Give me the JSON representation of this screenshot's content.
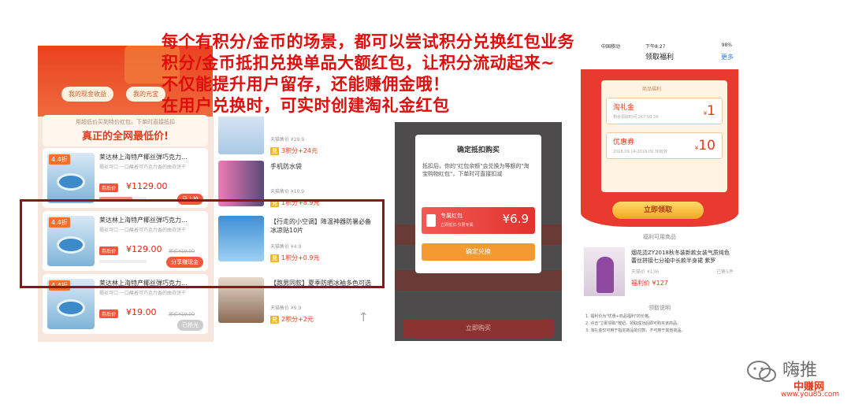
{
  "headline": [
    "每个有积分/金币的场景，都可以尝试积分兑换红包业务",
    "积分/金币抵扣兑换单品大额红包，让积分流动起来~",
    "不仅能提升用户留存，还能赚佣金哦！",
    "在用户兑换时，可实时创建淘礼金红包"
  ],
  "panel1": {
    "chips": [
      "我的现金收益",
      "我的元宝"
    ],
    "banner_small": "用超低价买到特价红包，下单时直接抵扣",
    "banner_title": "真正的全网最低价!",
    "cards": [
      {
        "discount": "4.4折",
        "title": "莱达林上海特产椰丝弹巧克力...",
        "sub": "椰丝可口 一口蘸着可巧克力香的曲奇饼干",
        "tag": "券后价",
        "price": "¥1129.00",
        "orig": "",
        "button": "马上抢",
        "progress": 0.7
      },
      {
        "discount": "4.4折",
        "title": "莱达林上海特产椰丝弹巧克力...",
        "sub": "椰丝可口 一口蘸着可巧克力香的曲奇饼干",
        "tag": "券后价",
        "price": "¥129.00",
        "orig": "原价¥59.00",
        "button": "分享赚现金",
        "progress": 0.0
      },
      {
        "discount": "4.4折",
        "title": "莱达林上海特产椰丝弹巧克力...",
        "sub": "椰丝可口 一口蘸着可巧克力香的曲奇饼干",
        "tag": "券后价",
        "price": "¥19.00",
        "orig": "原价¥59.00",
        "button": "已抢光",
        "progress": 0.0
      }
    ]
  },
  "panel2": {
    "products": [
      {
        "name": "",
        "market": "天猫售价 ¥29.9",
        "points": "3积分+24元",
        "badge": "兑"
      },
      {
        "name": "手机防水袋",
        "market": "天猫售价 ¥10.9",
        "points": "1积分+8.9元",
        "badge": "兑"
      },
      {
        "name": "【行走的小空调】降温神器防暑必备冰凉贴10片",
        "market": "天猫售价 ¥4.9",
        "points": "1积分+0.9元",
        "badge": "兑"
      },
      {
        "name": "【跑男同款】夏季防晒冰袖多色可选",
        "market": "天猫售价 ¥9.9",
        "points": "2积分+2元",
        "badge": "兑"
      }
    ],
    "back_top": "↑"
  },
  "panel3": {
    "modal_title": "确定抵扣购买",
    "modal_text": "抵扣后，你的\"红包余额\"会兑换为等额的\"淘宝购物红包\"，下单时可直接扣减",
    "packet_name": "专属红包",
    "packet_desc": "立即抵扣 仅限专属",
    "packet_amount": "¥6.9",
    "confirm": "确定兑换",
    "bottom_button": "立即购买"
  },
  "panel4": {
    "status_left": "中国移动",
    "status_time": "下午8:27",
    "status_right": "98%",
    "title": "领取福利",
    "more": "更多",
    "card_header": "商品福利",
    "coupons": [
      {
        "name": "淘礼金",
        "desc": "剩余领取时间 267:50:24",
        "value": "1"
      },
      {
        "name": "优惠券",
        "desc": "2018.09.14-2018.09.30有效",
        "value": "10"
      }
    ],
    "claim": "立即领取",
    "section1": "福利可用商品",
    "product": {
      "name": "烟花烫ZY2018秋冬装新款女装气质纯色蕾丝拼接七分袖中长款半身裙 紫罗",
      "market": "天猫价 ¥136",
      "sold": "已售5件",
      "price": "福利价 ¥127"
    },
    "section2": "领取说明",
    "rules": [
      "1. 福利价为\"优惠+商品福利\"的价格。",
      "2. 点击\"立即领取\"按钮，领取成功后即可购买该商品。",
      "3. 淘礼金仅可用于指定商品的付款，不可用于其他商品。"
    ]
  },
  "watermark": {
    "t1": "嗨推",
    "t2": "中赚网",
    "t3": "www.you85.com"
  }
}
